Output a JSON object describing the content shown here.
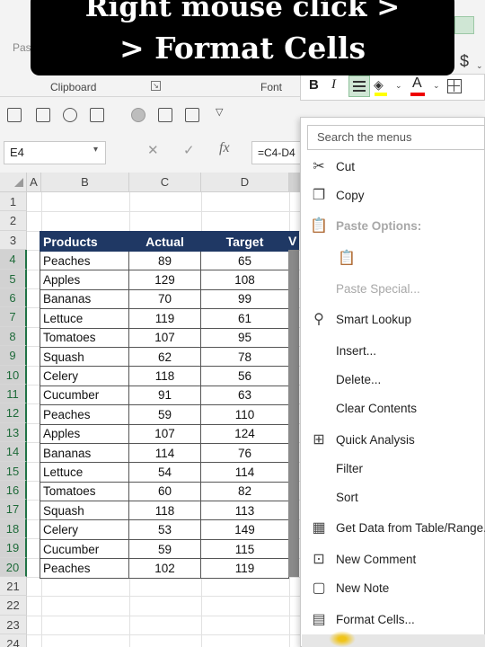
{
  "caption": {
    "line1": "Right mouse click >",
    "line2": "> Format Cells"
  },
  "ribbon": {
    "paste_stub": "Pas",
    "clipboard_label": "Clipboard",
    "font_label": "Font",
    "currency_symbol": "$"
  },
  "mini_toolbar": {
    "bold": "B",
    "italic": "I",
    "font_color": "A",
    "fill_color": "#ffff00",
    "text_color": "#e00000"
  },
  "formula_bar": {
    "name_box": "E4",
    "cancel": "✕",
    "enter": "✓",
    "fx": "fx",
    "formula": "=C4-D4"
  },
  "sheet": {
    "columns": [
      "A",
      "B",
      "C",
      "D"
    ],
    "rows": [
      "1",
      "2",
      "3",
      "4",
      "5",
      "6",
      "7",
      "8",
      "9",
      "10",
      "11",
      "12",
      "13",
      "14",
      "15",
      "16",
      "17",
      "18",
      "19",
      "20",
      "21",
      "22",
      "23",
      "24"
    ],
    "headers": [
      "Products",
      "Actual",
      "Target",
      "V"
    ],
    "table": [
      [
        "Peaches",
        "89",
        "65"
      ],
      [
        "Apples",
        "129",
        "108"
      ],
      [
        "Bananas",
        "70",
        "99"
      ],
      [
        "Lettuce",
        "119",
        "61"
      ],
      [
        "Tomatoes",
        "107",
        "95"
      ],
      [
        "Squash",
        "62",
        "78"
      ],
      [
        "Celery",
        "118",
        "56"
      ],
      [
        "Cucumber",
        "91",
        "63"
      ],
      [
        "Peaches",
        "59",
        "110"
      ],
      [
        "Apples",
        "107",
        "124"
      ],
      [
        "Bananas",
        "114",
        "76"
      ],
      [
        "Lettuce",
        "54",
        "114"
      ],
      [
        "Tomatoes",
        "60",
        "82"
      ],
      [
        "Squash",
        "118",
        "113"
      ],
      [
        "Celery",
        "53",
        "149"
      ],
      [
        "Cucumber",
        "59",
        "115"
      ],
      [
        "Peaches",
        "102",
        "119"
      ]
    ],
    "header_color": "#1f3864"
  },
  "context_menu": {
    "search_placeholder": "Search the menus",
    "items": [
      {
        "label": "Cut",
        "icon": "scissors-icon",
        "enabled": true
      },
      {
        "label": "Copy",
        "icon": "copy-icon",
        "enabled": true
      },
      {
        "label": "Paste Options:",
        "icon": "paste-icon",
        "enabled": false
      },
      {
        "label": "Paste Special...",
        "icon": "",
        "enabled": false
      },
      {
        "label": "Smart Lookup",
        "icon": "lookup-icon",
        "enabled": true
      },
      {
        "label": "Insert...",
        "icon": "",
        "enabled": true
      },
      {
        "label": "Delete...",
        "icon": "",
        "enabled": true
      },
      {
        "label": "Clear Contents",
        "icon": "",
        "enabled": true
      },
      {
        "label": "Quick Analysis",
        "icon": "quick-analysis-icon",
        "enabled": true
      },
      {
        "label": "Filter",
        "icon": "",
        "enabled": true
      },
      {
        "label": "Sort",
        "icon": "",
        "enabled": true
      },
      {
        "label": "Get Data from Table/Range...",
        "icon": "table-icon",
        "enabled": true
      },
      {
        "label": "New Comment",
        "icon": "comment-icon",
        "enabled": true
      },
      {
        "label": "New Note",
        "icon": "note-icon",
        "enabled": true
      },
      {
        "label": "Format Cells...",
        "icon": "format-cells-icon",
        "enabled": true
      }
    ]
  }
}
